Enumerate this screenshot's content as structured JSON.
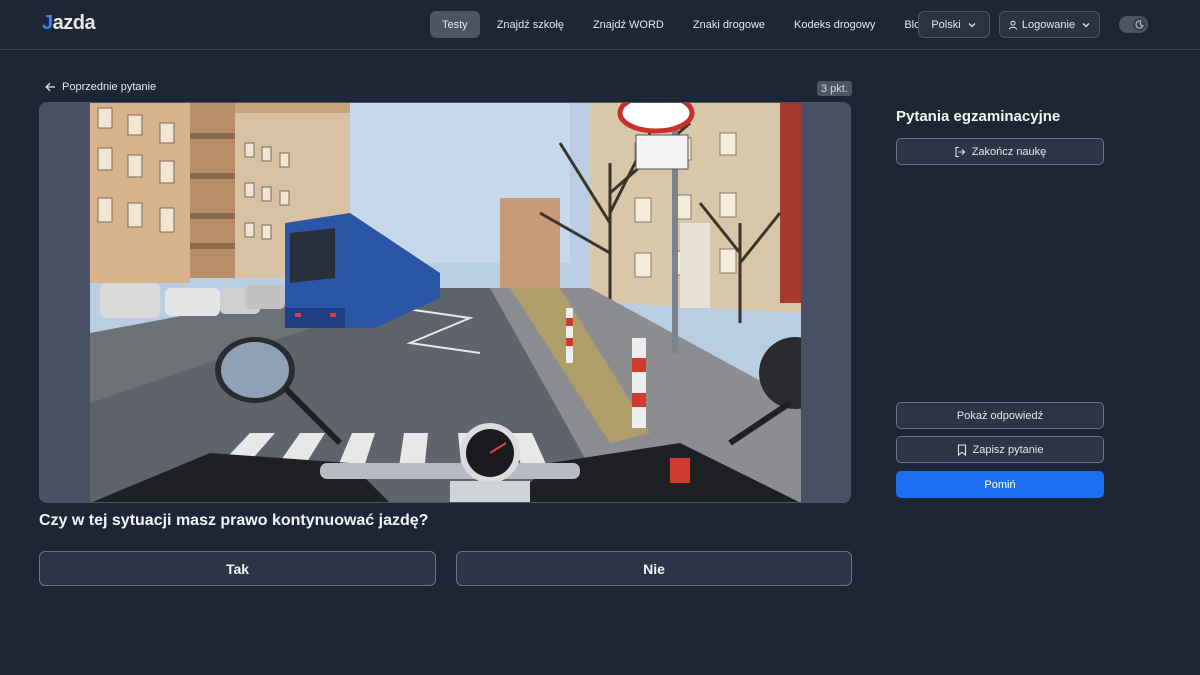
{
  "header": {
    "logo_text": "azda",
    "logo_j": "J",
    "nav": [
      "Testy",
      "Znajdź szkołę",
      "Znajdź WORD",
      "Znaki drogowe",
      "Kodeks drogowy",
      "Blog"
    ],
    "active_nav": "Testy",
    "language": "Polski",
    "login": "Logowanie",
    "theme_icon": "moon-icon"
  },
  "main": {
    "back_label": "Poprzednie pytanie",
    "points": "3 pkt.",
    "question": "Czy w tej sytuacji masz prawo kontynuować jazdę?",
    "answers": [
      "Tak",
      "Nie"
    ]
  },
  "sidebar": {
    "title": "Pytania egzaminacyjne",
    "finish": "Zakończ naukę",
    "show_answer": "Pokaż odpowiedź",
    "save_question": "Zapisz pytanie",
    "skip": "Pomiń"
  },
  "colors": {
    "background": "#1e2636",
    "accent": "#1d6ff2",
    "active_tab": "#4b5563"
  }
}
